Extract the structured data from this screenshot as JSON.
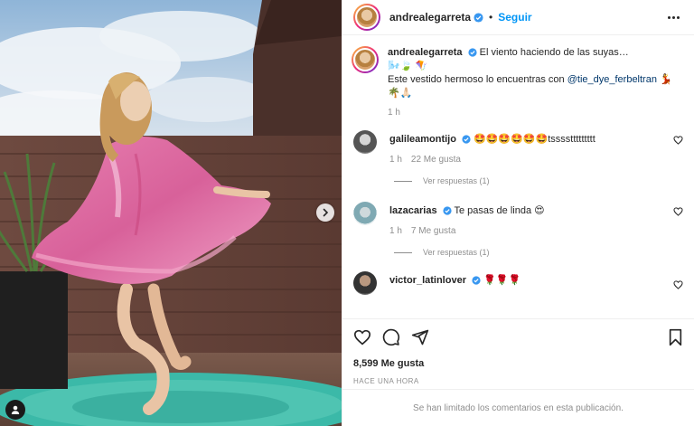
{
  "post": {
    "author": "andrealegarreta",
    "follow_label": "Seguir",
    "separator": "•"
  },
  "caption": {
    "username": "andrealegarreta",
    "line1": "El viento haciendo de las suyas…",
    "line2_emoji": "🌬️🍃 🪁",
    "line3_prefix": "Este vestido hermoso lo encuentras con ",
    "mention": "@tie_dye_ferbeltran",
    "line3_suffix": " 💃",
    "line4_emoji": "🌴🙏🏻",
    "time": "1 h"
  },
  "comments": [
    {
      "username": "galileamontijo",
      "text": "🤩🤩🤩🤩🤩🤩tssssttttttttt",
      "time": "1 h",
      "likes": "22 Me gusta",
      "replies": "Ver respuestas (1)"
    },
    {
      "username": "lazacarias",
      "text": "Te pasas de linda 😍",
      "time": "1 h",
      "likes": "7 Me gusta",
      "replies": "Ver respuestas (1)"
    },
    {
      "username": "victor_latinlover",
      "text": "🌹🌹🌹"
    }
  ],
  "footer": {
    "likes_count": "8,599 Me gusta",
    "timestamp": "Hace una hora",
    "limited": "Se han limitado los comentarios en esta publicación."
  },
  "icons": {
    "verified": "verified-badge-icon",
    "next": "chevron-right-icon",
    "tag": "user-tag-icon",
    "like": "heart-icon",
    "comment": "comment-icon",
    "share": "paper-plane-icon",
    "save": "bookmark-icon",
    "more": "more-horizontal-icon"
  },
  "colors": {
    "accent": "#0095f6",
    "verified": "#3897f0",
    "text": "#262626",
    "muted": "#8e8e8e"
  }
}
